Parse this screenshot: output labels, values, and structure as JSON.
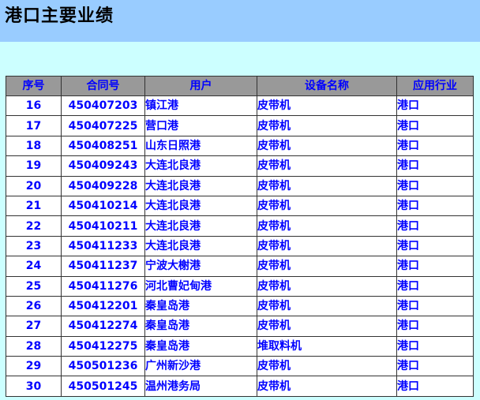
{
  "page": {
    "title": "港口主要业绩"
  },
  "table": {
    "headers": {
      "seq": "序号",
      "contract": "合同号",
      "user": "用户",
      "device": "设备名称",
      "industry": "应用行业"
    },
    "rows": [
      {
        "seq": "16",
        "contract": "450407203",
        "user": "镇江港",
        "device": "皮带机",
        "industry": "港口"
      },
      {
        "seq": "17",
        "contract": "450407225",
        "user": "营口港",
        "device": "皮带机",
        "industry": "港口"
      },
      {
        "seq": "18",
        "contract": "450408251",
        "user": "山东日照港",
        "device": "皮带机",
        "industry": "港口"
      },
      {
        "seq": "19",
        "contract": "450409243",
        "user": "大连北良港",
        "device": "皮带机",
        "industry": "港口"
      },
      {
        "seq": "20",
        "contract": "450409228",
        "user": "大连北良港",
        "device": "皮带机",
        "industry": "港口"
      },
      {
        "seq": "21",
        "contract": "450410214",
        "user": "大连北良港",
        "device": "皮带机",
        "industry": "港口"
      },
      {
        "seq": "22",
        "contract": "450410211",
        "user": "大连北良港",
        "device": "皮带机",
        "industry": "港口"
      },
      {
        "seq": "23",
        "contract": "450411233",
        "user": "大连北良港",
        "device": "皮带机",
        "industry": "港口"
      },
      {
        "seq": "24",
        "contract": "450411237",
        "user": "宁波大榭港",
        "device": "皮带机",
        "industry": "港口"
      },
      {
        "seq": "25",
        "contract": "450411276",
        "user": "河北曹妃甸港",
        "device": "皮带机",
        "industry": "港口"
      },
      {
        "seq": "26",
        "contract": "450412201",
        "user": "秦皇岛港",
        "device": "皮带机",
        "industry": "港口"
      },
      {
        "seq": "27",
        "contract": "450412274",
        "user": "秦皇岛港",
        "device": "皮带机",
        "industry": "港口"
      },
      {
        "seq": "28",
        "contract": "450412275",
        "user": "秦皇岛港",
        "device": "堆取料机",
        "industry": "港口"
      },
      {
        "seq": "29",
        "contract": "450501236",
        "user": "广州新沙港",
        "device": "皮带机",
        "industry": "港口"
      },
      {
        "seq": "30",
        "contract": "450501245",
        "user": "温州港务局",
        "device": "皮带机",
        "industry": "港口"
      }
    ]
  },
  "colors": {
    "background": "#ccffff",
    "title_bar": "#99ccff",
    "header_bg": "#999999",
    "text": "#0000ff"
  }
}
